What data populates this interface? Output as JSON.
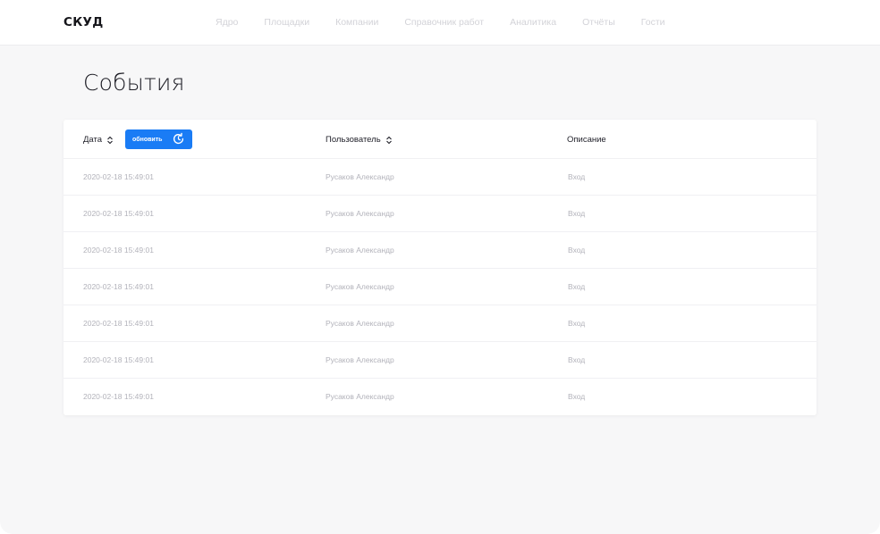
{
  "app": {
    "logo": "СКУД"
  },
  "nav": {
    "items": [
      "Ядро",
      "Площадки",
      "Компании",
      "Справочник работ",
      "Аналитика",
      "Отчёты",
      "Гости"
    ]
  },
  "page": {
    "title": "События"
  },
  "table": {
    "columns": {
      "date": "Дата",
      "user": "Пользователь",
      "description": "Описание"
    },
    "refresh_label": "обновить",
    "rows": [
      {
        "date": "2020-02-18 15:49:01",
        "user": "Русаков Александр",
        "description": "Вход"
      },
      {
        "date": "2020-02-18 15:49:01",
        "user": "Русаков Александр",
        "description": "Вход"
      },
      {
        "date": "2020-02-18 15:49:01",
        "user": "Русаков Александр",
        "description": "Вход"
      },
      {
        "date": "2020-02-18 15:49:01",
        "user": "Русаков Александр",
        "description": "Вход"
      },
      {
        "date": "2020-02-18 15:49:01",
        "user": "Русаков Александр",
        "description": "Вход"
      },
      {
        "date": "2020-02-18 15:49:01",
        "user": "Русаков Александр",
        "description": "Вход"
      },
      {
        "date": "2020-02-18 15:49:01",
        "user": "Русаков Александр",
        "description": "Вход"
      }
    ]
  },
  "colors": {
    "accent": "#1a7cf5",
    "nav_text": "#d3d3d8",
    "cell_text": "#b2b2ba",
    "background": "#f7f7f8"
  },
  "icons": {
    "sort": "sort-icon",
    "refresh": "refresh-icon"
  }
}
